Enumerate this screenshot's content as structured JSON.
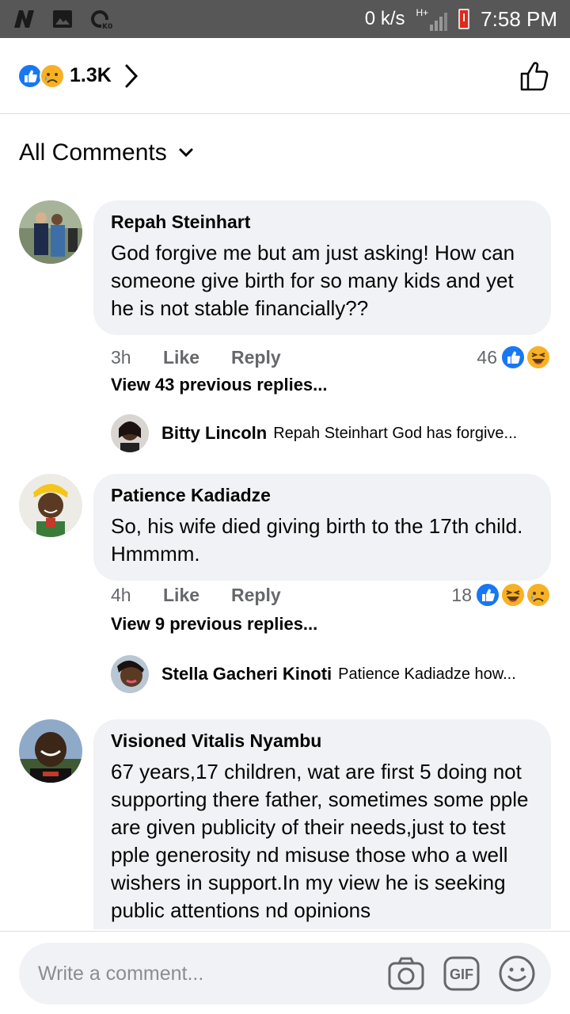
{
  "status_bar": {
    "speed": "0 k/s",
    "network": "H+",
    "time": "7:58 PM"
  },
  "reactions_header": {
    "count": "1.3K",
    "icons": [
      "like-icon",
      "sad-icon"
    ]
  },
  "filter": {
    "label": "All Comments"
  },
  "comments": [
    {
      "author": "Repah Steinhart",
      "text": "God forgive me but am just asking! How can someone give birth for so many kids and yet he is not stable financially??",
      "time": "3h",
      "like_label": "Like",
      "reply_label": "Reply",
      "reaction_count": "46",
      "reaction_icons": [
        "like-icon",
        "haha-icon"
      ],
      "view_replies": "View 43 previous replies...",
      "reply_preview": {
        "author": "Bitty Lincoln",
        "text": "Repah Steinhart  God has forgive..."
      }
    },
    {
      "author": "Patience Kadiadze",
      "text": "So, his wife died giving birth to the 17th child. Hmmmm.",
      "time": "4h",
      "like_label": "Like",
      "reply_label": "Reply",
      "reaction_count": "18",
      "reaction_icons": [
        "like-icon",
        "haha-icon",
        "sad-icon"
      ],
      "view_replies": "View 9 previous replies...",
      "reply_preview": {
        "author": "Stella Gacheri Kinoti",
        "text": "Patience Kadiadze how..."
      }
    },
    {
      "author": "Visioned Vitalis Nyambu",
      "text": "67 years,17 children, wat are first 5 doing not supporting there father, sometimes some pple are given publicity of their needs,just to test pple generosity nd misuse those who a well wishers in support.In my view he is seeking public attentions nd opinions"
    }
  ],
  "composer": {
    "placeholder": "Write a comment...",
    "icons": [
      "camera-icon",
      "gif-icon",
      "emoji-icon"
    ]
  },
  "colors": {
    "like_blue": "#1877f2",
    "emoji_yellow": "#f7b125",
    "bubble_gray": "#f0f2f5",
    "status_bar": "#575757"
  }
}
